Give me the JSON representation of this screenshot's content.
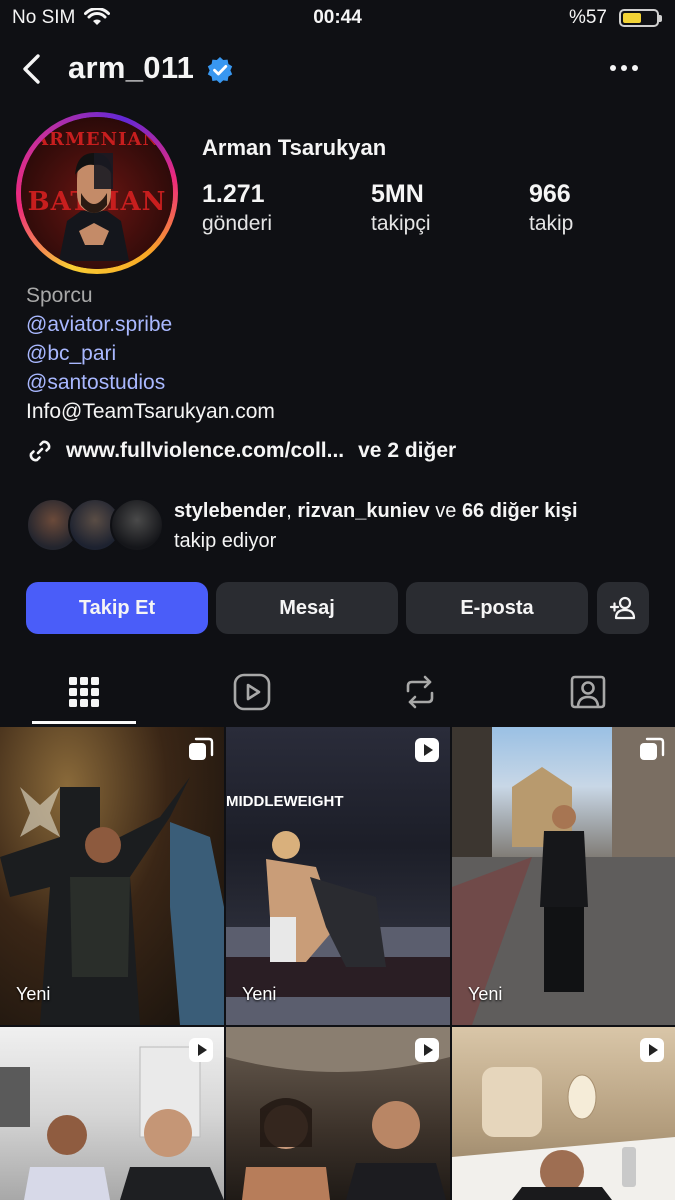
{
  "status_bar": {
    "carrier": "No SIM",
    "time": "00:44",
    "battery_text": "%57",
    "battery_level": 0.57
  },
  "header": {
    "username": "arm_011",
    "back_icon": "chevron-left-icon",
    "verified_icon": "verified-badge-icon",
    "more_icon": "more-horizontal-icon"
  },
  "profile": {
    "name": "Arman Tsarukyan",
    "avatar_text_top": "ARMENIAN",
    "avatar_text_bottom": "BATMAN",
    "stats": [
      {
        "value": "1.271",
        "label": "gönderi"
      },
      {
        "value": "5MN",
        "label": "takipçi"
      },
      {
        "value": "966",
        "label": "takip"
      }
    ]
  },
  "bio": {
    "category": "Sporcu",
    "mentions": [
      "@aviator.spribe",
      "@bc_pari",
      "@santostudios"
    ],
    "email": "Info@TeamTsarukyan.com",
    "link": "www.fullviolence.com/coll...",
    "link_extra": "ve 2 diğer",
    "link_icon": "link-icon"
  },
  "followed_by": {
    "user1": "stylebender",
    "sep": ", ",
    "user2": "rizvan_kuniev",
    "and": " ve ",
    "others": "66 diğer kişi",
    "suffix": "takip ediyor"
  },
  "actions": {
    "follow": "Takip Et",
    "message": "Mesaj",
    "email": "E-posta",
    "add_user_icon": "add-person-icon"
  },
  "tabs": [
    {
      "name": "posts",
      "icon": "grid-icon",
      "active": true
    },
    {
      "name": "reels",
      "icon": "reels-icon",
      "active": false
    },
    {
      "name": "reposts",
      "icon": "repost-icon",
      "active": false
    },
    {
      "name": "tagged",
      "icon": "tagged-icon",
      "active": false
    }
  ],
  "grid": [
    {
      "badge": "Yeni",
      "icon": "carousel-icon",
      "banner": ""
    },
    {
      "badge": "Yeni",
      "icon": "reel-icon",
      "banner": "MIDDLEWEIGHT"
    },
    {
      "badge": "Yeni",
      "icon": "carousel-icon",
      "banner": ""
    },
    {
      "badge": "",
      "icon": "reel-icon",
      "banner": ""
    },
    {
      "badge": "",
      "icon": "reel-icon",
      "banner": ""
    },
    {
      "badge": "",
      "icon": "reel-icon",
      "banner": ""
    }
  ],
  "colors": {
    "background": "#0f1014",
    "primary_button": "#4a5df9",
    "secondary_button": "#2a2c31",
    "link": "#a9b8ff",
    "verified": "#3897f0"
  }
}
